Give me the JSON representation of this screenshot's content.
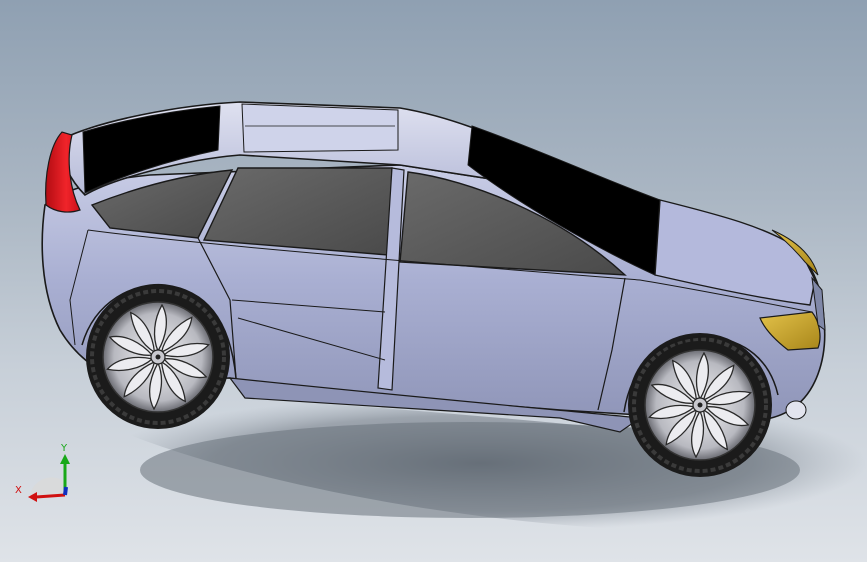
{
  "viewport": {
    "background_top": "#8fa0b2",
    "background_bottom": "#dfe3e8"
  },
  "model": {
    "body_color": "#a8aed0",
    "glass_color": "#555555",
    "roof_glass_color": "#000000",
    "tail_light_color": "#e8131b",
    "head_light_color": "#c9a830",
    "tire_color": "#1b1b1b",
    "rim_color": "#d8d8dc"
  },
  "triad": {
    "x_label": "X",
    "y_label": "Y",
    "x_color": "#d01010",
    "y_color": "#18a818",
    "z_color": "#1030c0",
    "x_icon": "x-axis-arrow-icon",
    "y_icon": "y-axis-arrow-icon"
  }
}
